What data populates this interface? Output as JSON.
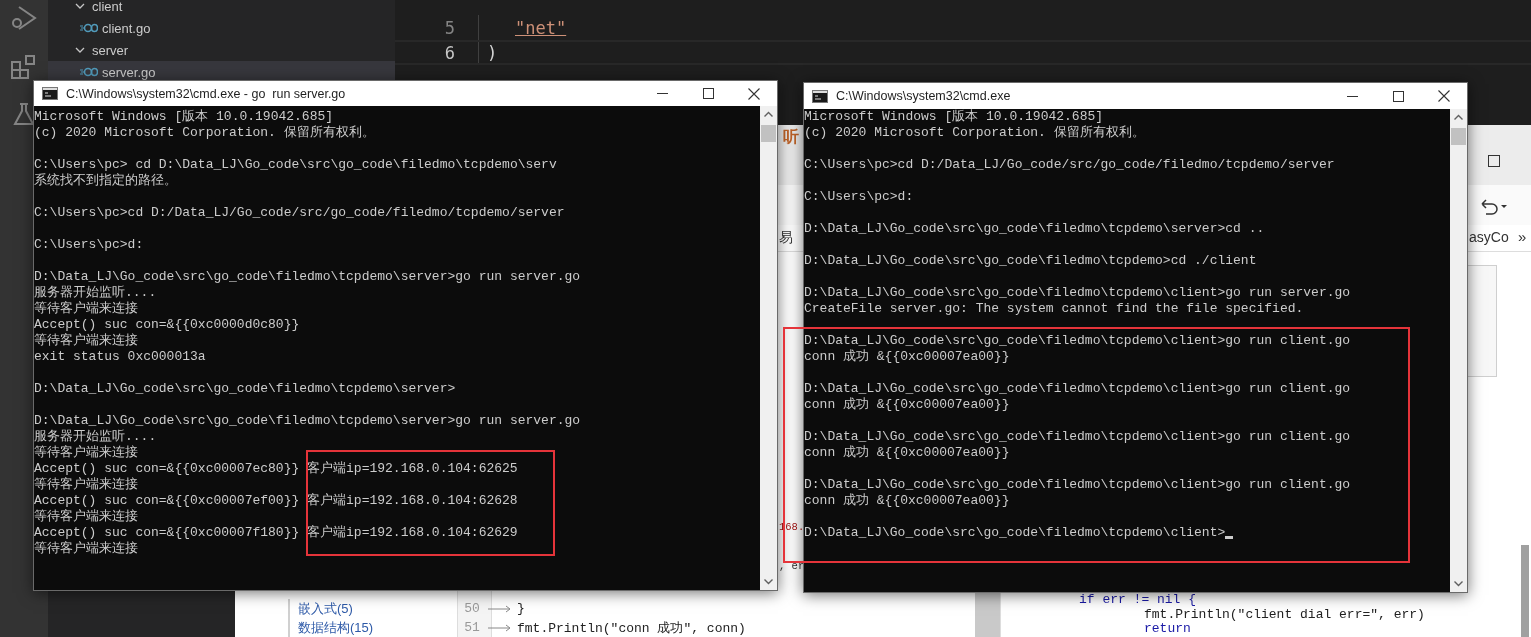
{
  "vscode": {
    "explorer": [
      {
        "label": "client",
        "kind": "folder",
        "expanded": true,
        "selected": false,
        "children": [
          {
            "label": "client.go",
            "kind": "file",
            "selected": false
          }
        ]
      },
      {
        "label": "server",
        "kind": "folder",
        "expanded": true,
        "selected": false,
        "children": [
          {
            "label": "server.go",
            "kind": "file",
            "selected": true
          }
        ]
      }
    ],
    "editor": [
      {
        "number": "5",
        "code": "\"net\"",
        "kind": "string",
        "current": false
      },
      {
        "number": "6",
        "code": ")",
        "kind": "punctuation",
        "current": true
      }
    ]
  },
  "browser": {
    "tab_title": "听",
    "bookmarks": [
      "易",
      "asyCo"
    ],
    "more": "»",
    "categories": [
      "嵌入式(5)",
      "数据结构(15)"
    ],
    "editor_lines": [
      {
        "number": "50",
        "code": "}"
      },
      {
        "number": "51",
        "code": "fmt.Println(\"conn 成功\", conn)"
      }
    ],
    "fragments": [
      {
        "text": "168.",
        "kind": "string"
      },
      {
        "text": ", er",
        "kind": "plain"
      }
    ],
    "preview_lines": [
      {
        "code": "if err != nil {",
        "kind": "keyword"
      },
      {
        "code": "fmt.Println(\"client dial err=\", err)",
        "kind": "plain"
      },
      {
        "code": "return",
        "kind": "keyword"
      }
    ]
  },
  "terminals": [
    {
      "title": "C:\\Windows\\system32\\cmd.exe - go  run server.go",
      "highlight": true,
      "cursor": false,
      "blocks": [
        [
          "Microsoft Windows [版本 10.0.19042.685]",
          "(c) 2020 Microsoft Corporation. 保留所有权利。"
        ],
        [
          "C:\\Users\\pc> cd D:\\Data_LJ\\Go_code\\src\\go_code\\filedmo\\tcpdemo\\serv",
          "系统找不到指定的路径。"
        ],
        [
          "C:\\Users\\pc>cd D:/Data_LJ/Go_code/src/go_code/filedmo/tcpdemo/server"
        ],
        [
          "C:\\Users\\pc>d:"
        ],
        [
          "D:\\Data_LJ\\Go_code\\src\\go_code\\filedmo\\tcpdemo\\server>go run server.go",
          "服务器开始监听....",
          "等待客户端来连接",
          "Accept() suc con=&{{0xc0000d0c80}}",
          "等待客户端来连接",
          "exit status 0xc000013a"
        ],
        [
          "D:\\Data_LJ\\Go_code\\src\\go_code\\filedmo\\tcpdemo\\server>"
        ],
        [
          "D:\\Data_LJ\\Go_code\\src\\go_code\\filedmo\\tcpdemo\\server>go run server.go",
          "服务器开始监听....",
          "等待客户端来连接",
          "Accept() suc con=&{{0xc00007ec80}} 客户端ip=192.168.0.104:62625",
          "等待客户端来连接",
          "Accept() suc con=&{{0xc00007ef00}} 客户端ip=192.168.0.104:62628",
          "等待客户端来连接",
          "Accept() suc con=&{{0xc00007f180}} 客户端ip=192.168.0.104:62629",
          "等待客户端来连接"
        ]
      ]
    },
    {
      "title": "C:\\Windows\\system32\\cmd.exe",
      "highlight": true,
      "cursor": true,
      "blocks": [
        [
          "Microsoft Windows [版本 10.0.19042.685]",
          "(c) 2020 Microsoft Corporation. 保留所有权利。"
        ],
        [
          "C:\\Users\\pc>cd D:/Data_LJ/Go_code/src/go_code/filedmo/tcpdemo/server"
        ],
        [
          "C:\\Users\\pc>d:"
        ],
        [
          "D:\\Data_LJ\\Go_code\\src\\go_code\\filedmo\\tcpdemo\\server>cd .."
        ],
        [
          "D:\\Data_LJ\\Go_code\\src\\go_code\\filedmo\\tcpdemo>cd ./client"
        ],
        [
          "D:\\Data_LJ\\Go_code\\src\\go_code\\filedmo\\tcpdemo\\client>go run server.go",
          "CreateFile server.go: The system cannot find the file specified."
        ],
        [
          "D:\\Data_LJ\\Go_code\\src\\go_code\\filedmo\\tcpdemo\\client>go run client.go",
          "conn 成功 &{{0xc00007ea00}}"
        ],
        [
          "D:\\Data_LJ\\Go_code\\src\\go_code\\filedmo\\tcpdemo\\client>go run client.go",
          "conn 成功 &{{0xc00007ea00}}"
        ],
        [
          "D:\\Data_LJ\\Go_code\\src\\go_code\\filedmo\\tcpdemo\\client>go run client.go",
          "conn 成功 &{{0xc00007ea00}}"
        ],
        [
          "D:\\Data_LJ\\Go_code\\src\\go_code\\filedmo\\tcpdemo\\client>go run client.go",
          "conn 成功 &{{0xc00007ea00}}"
        ],
        [
          "D:\\Data_LJ\\Go_code\\src\\go_code\\filedmo\\tcpdemo\\client>"
        ]
      ]
    }
  ]
}
